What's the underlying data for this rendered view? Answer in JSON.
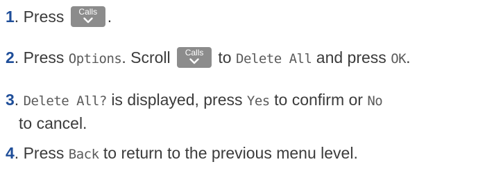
{
  "steps": [
    {
      "number": "1",
      "text_before": "Press",
      "key_label": "Calls",
      "text_after": "."
    },
    {
      "number": "2",
      "text_a": "Press",
      "display_options": "Options",
      "text_b": ". Scroll",
      "key_label": "Calls",
      "text_c": "to",
      "display_delete_all": "Delete All",
      "text_d": "and press",
      "display_ok": "OK",
      "text_e": "."
    },
    {
      "number": "3",
      "display_prompt": "Delete All?",
      "text_a": "is displayed, press",
      "display_yes": "Yes",
      "text_b": "to confirm or",
      "display_no": "No",
      "text_c": "to cancel."
    },
    {
      "number": "4",
      "text_a": "Press",
      "display_back": "Back",
      "text_b": "to return to the previous menu level."
    }
  ],
  "colors": {
    "step_number": "#1f4e99",
    "key_background": "#8c8c8c",
    "body_text": "#3b3b3b"
  },
  "icons": {
    "key_arrow": "chevron-down-icon"
  }
}
